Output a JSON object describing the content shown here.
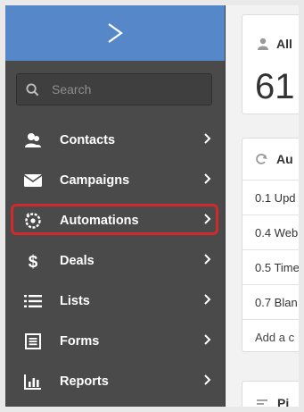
{
  "sidebar": {
    "search": {
      "placeholder": "Search"
    },
    "items": [
      {
        "label": "Contacts"
      },
      {
        "label": "Campaigns"
      },
      {
        "label": "Automations"
      },
      {
        "label": "Deals"
      },
      {
        "label": "Lists"
      },
      {
        "label": "Forms"
      },
      {
        "label": "Reports"
      }
    ]
  },
  "main": {
    "card1": {
      "title": "All",
      "value": "61"
    },
    "card2": {
      "title": "Au",
      "rows": [
        "0.1 Upd",
        "0.4 Web",
        "0.5 Time",
        "0.7 Blan"
      ],
      "add_label": "Add a c"
    },
    "card3": {
      "title": "Pi"
    }
  },
  "colors": {
    "brand_bar": "#5587c9",
    "sidebar_bg": "#4a4a4a",
    "highlight": "#d22a2a"
  }
}
